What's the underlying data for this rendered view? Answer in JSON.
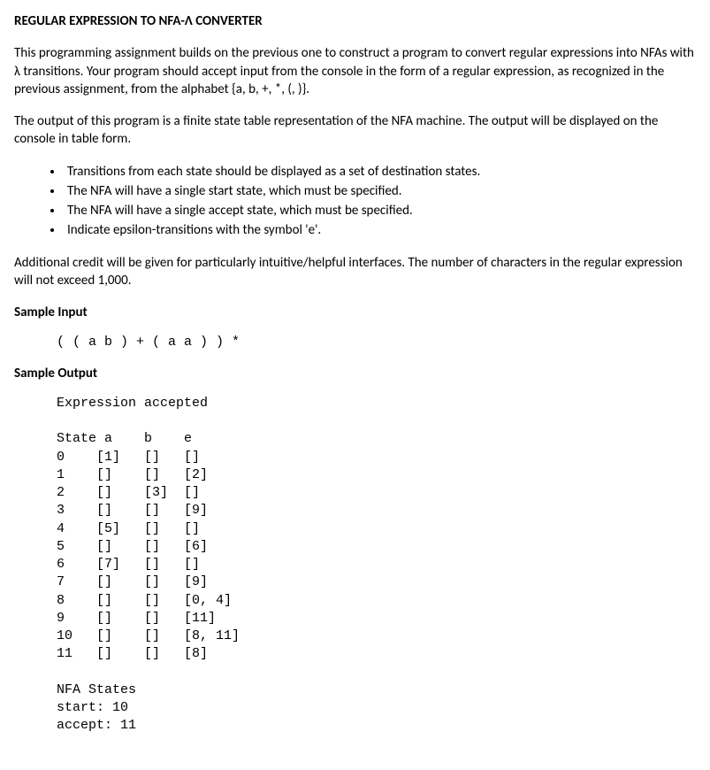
{
  "title": "REGULAR EXPRESSION TO NFA-Λ CONVERTER",
  "para1": "This programming assignment builds on the previous one to construct a program to convert regular expressions into NFAs with λ transitions.  Your program should accept input from the console in the form of a regular expression, as recognized in the previous assignment, from the alphabet {a, b, +, *, (, )}.",
  "para2": "The output of this program is a finite state table representation of the NFA machine.  The output will be displayed on the console in table form.",
  "bullets": [
    "Transitions from each state should be displayed as a set of destination states.",
    "The NFA will have a single start state, which must be specified.",
    "The NFA will have a single accept state, which must be specified.",
    "Indicate epsilon-transitions with the symbol 'e'."
  ],
  "para3": "Additional credit will be given for particularly intuitive/helpful interfaces.  The number of characters in the regular expression will not exceed 1,000.",
  "sampleInputLabel": "Sample Input",
  "sampleInput": "( ( a b ) + ( a a ) ) *",
  "sampleOutputLabel": "Sample Output",
  "sampleOutput": "Expression accepted\n\nState a    b    e\n0    [1]   []   []\n1    []    []   [2]\n2    []    [3]  []\n3    []    []   [9]\n4    [5]   []   []\n5    []    []   [6]\n6    [7]   []   []\n7    []    []   [9]\n8    []    []   [0, 4]\n9    []    []   [11]\n10   []    []   [8, 11]\n11   []    []   [8]\n\nNFA States\nstart: 10\naccept: 11"
}
